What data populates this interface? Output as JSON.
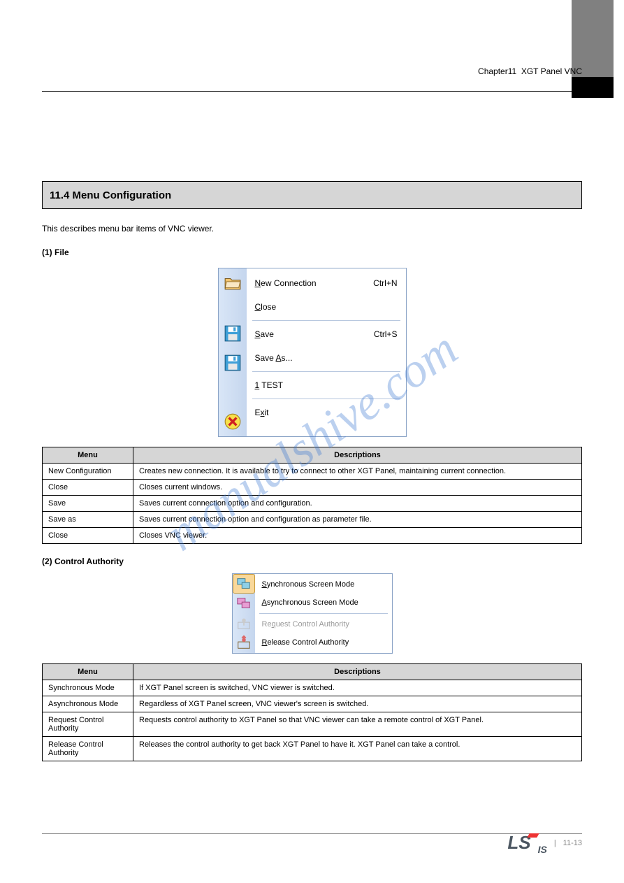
{
  "header": {
    "chapter_line": "Chapter11  XGT Panel VNC"
  },
  "section_bar": "11.4  Menu Configuration",
  "intro": "This describes menu bar items of VNC viewer.",
  "sub_file": "(1)  File",
  "file_menu": {
    "items": [
      {
        "label_html": "<span class='u'>N</span>ew Connection",
        "shortcut": "Ctrl+N",
        "icon": "open-folder-icon"
      },
      {
        "label_html": "<span class='u'>C</span>lose",
        "shortcut": "",
        "icon": ""
      },
      {
        "label_html": "<span class='u'>S</span>ave",
        "shortcut": "Ctrl+S",
        "icon": "floppy-icon"
      },
      {
        "label_html": "Save <span class='u'>A</span>s...",
        "shortcut": "",
        "icon": "floppy-icon"
      },
      {
        "label_html": "<span class='u'>1</span> TEST",
        "shortcut": "",
        "icon": ""
      },
      {
        "label_html": "E<span class='u'>x</span>it",
        "shortcut": "",
        "icon": "close-x-icon"
      }
    ]
  },
  "table1": {
    "headers": [
      "Menu",
      "Descriptions"
    ],
    "rows": [
      [
        "New Configuration",
        "Creates new connection. It is available to try to connect to other XGT Panel, maintaining current connection."
      ],
      [
        "Close",
        "Closes current windows."
      ],
      [
        "Save",
        "Saves current connection option and configuration."
      ],
      [
        "Save as",
        "Saves current connection option and configuration as parameter file."
      ],
      [
        "Close",
        "Closes VNC viewer."
      ]
    ]
  },
  "sub_control": "(2) Control Authority",
  "control_menu": {
    "items": [
      {
        "label_html": "<span class='u'>S</span>ynchronous Screen Mode",
        "icon": "sync-icon",
        "disabled": false,
        "selected": true
      },
      {
        "label_html": "<span class='u'>A</span>synchronous Screen Mode",
        "icon": "async-icon",
        "disabled": false,
        "selected": false
      },
      {
        "label_html": "Re<span class='u'>q</span>uest Control Authority",
        "icon": "auth-icon",
        "disabled": true,
        "selected": false
      },
      {
        "label_html": "<span class='u'>R</span>elease Control Authority",
        "icon": "auth-icon",
        "disabled": false,
        "selected": false
      }
    ]
  },
  "table2": {
    "headers": [
      "Menu",
      "Descriptions"
    ],
    "rows": [
      [
        "Synchronous Mode",
        "If XGT Panel screen is switched, VNC viewer is switched."
      ],
      [
        "Asynchronous Mode",
        "Regardless of XGT Panel screen, VNC viewer's screen is switched."
      ],
      [
        "Request Control Authority",
        "Requests control authority to XGT Panel so that VNC viewer can take a remote control of XGT Panel."
      ],
      [
        "Release Control Authority",
        "Releases the control authority to get back XGT Panel to have it. XGT Panel can take a control."
      ]
    ]
  },
  "footer": {
    "page": "11-13",
    "logo_text": "LS",
    "logo_sub": "IS"
  }
}
